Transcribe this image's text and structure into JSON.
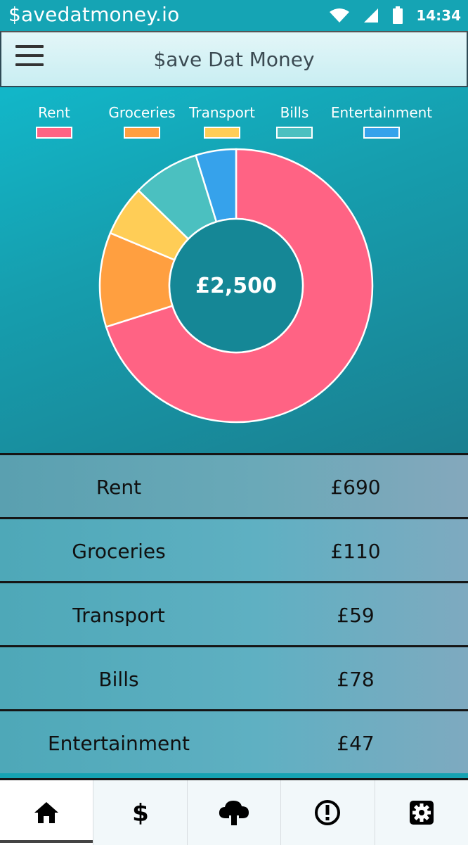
{
  "status_bar": {
    "title": "$avedatmoney.io",
    "time": "14:34",
    "icons": [
      "wifi-icon",
      "signal-icon",
      "battery-icon"
    ]
  },
  "app_bar": {
    "menu_icon": "hamburger-menu-icon",
    "title": "$ave Dat Money"
  },
  "chart_data": {
    "type": "pie",
    "style": "donut",
    "center_label": "£2,500",
    "legend_position": "top",
    "categories": [
      "Rent",
      "Groceries",
      "Transport",
      "Bills",
      "Entertainment"
    ],
    "values": [
      690,
      110,
      59,
      78,
      47
    ],
    "colors": [
      "#ff6384",
      "#ff9f40",
      "#ffcd56",
      "#4bc0c0",
      "#36a2eb"
    ]
  },
  "expenses": [
    {
      "name": "Rent",
      "amount": "£690"
    },
    {
      "name": "Groceries",
      "amount": "£110"
    },
    {
      "name": "Transport",
      "amount": "£59"
    },
    {
      "name": "Bills",
      "amount": "£78"
    },
    {
      "name": "Entertainment",
      "amount": "£47"
    }
  ],
  "bottom_nav": [
    {
      "icon": "home-icon",
      "active": true
    },
    {
      "icon": "dollar-icon",
      "active": false
    },
    {
      "icon": "cloud-upload-icon",
      "active": false
    },
    {
      "icon": "alert-icon",
      "active": false
    },
    {
      "icon": "settings-icon",
      "active": false
    }
  ]
}
